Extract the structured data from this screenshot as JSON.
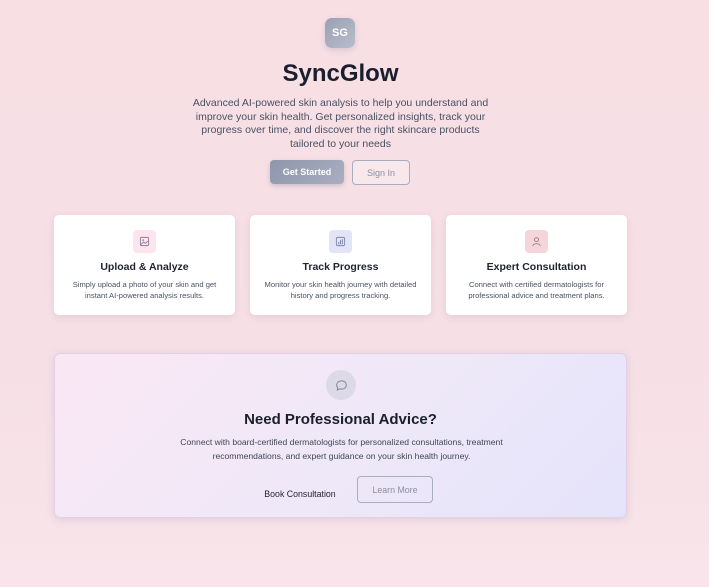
{
  "logo": {
    "initials": "SG"
  },
  "title": "SyncGlow",
  "tagline": "Advanced AI-powered skin analysis to help you understand and improve your skin health. Get personalized insights, track your progress over time, and discover the right skincare products tailored to your needs",
  "buttons": {
    "get_started": "Get Started",
    "sign_in": "Sign In"
  },
  "features": [
    {
      "icon": "image-icon",
      "title": "Upload & Analyze",
      "description": "Simply upload a photo of your skin and get instant AI-powered analysis results.",
      "color": "#fde5f0"
    },
    {
      "icon": "bar-chart-icon",
      "title": "Track Progress",
      "description": "Monitor your skin health journey with detailed history and progress tracking.",
      "color": "#e2e4f8"
    },
    {
      "icon": "user-icon",
      "title": "Expert Consultation",
      "description": "Connect with certified dermatologists for professional advice and treatment plans.",
      "color": "#f6d5da"
    }
  ],
  "cta": {
    "icon": "chat-icon",
    "title": "Need Professional Advice?",
    "description": "Connect with board-certified dermatologists for personalized consultations, treatment recommendations, and expert guidance on your skin health journey.",
    "book_label": "Book Consultation",
    "learn_label": "Learn More"
  },
  "colors": {
    "accent": "#9aa0b3",
    "background": "#f7dfe4"
  }
}
